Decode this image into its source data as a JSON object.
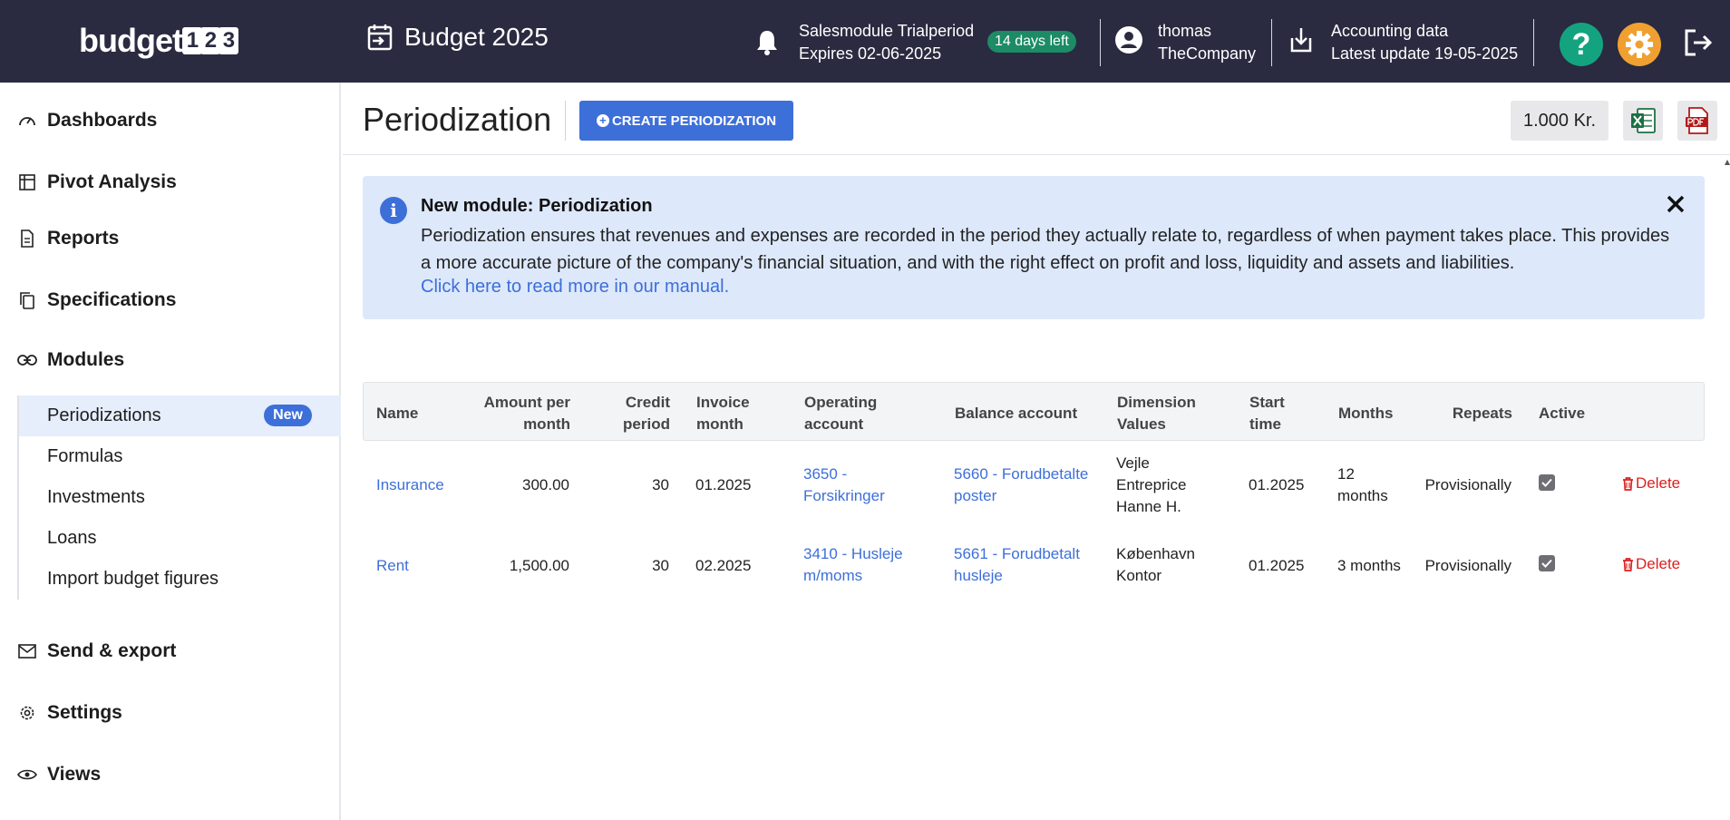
{
  "topbar": {
    "logo_text": "budget",
    "logo_digits": [
      "1",
      "2",
      "3"
    ],
    "budget_label": "Budget 2025",
    "trial_line1": "Salesmodule Trialperiod",
    "trial_line2": "Expires 02-06-2025",
    "days_left": "14 days left",
    "user_name": "thomas",
    "company": "TheCompany",
    "accounting_line1": "Accounting data",
    "accounting_line2": "Latest update 19-05-2025",
    "help_glyph": "?"
  },
  "sidebar": {
    "items": [
      {
        "label": "Dashboards",
        "icon": "gauge-icon"
      },
      {
        "label": "Pivot Analysis",
        "icon": "table-icon"
      },
      {
        "label": "Reports",
        "icon": "document-icon"
      },
      {
        "label": "Specifications",
        "icon": "copy-icon"
      },
      {
        "label": "Modules",
        "icon": "link-icon"
      },
      {
        "label": "Send & export",
        "icon": "envelope-icon"
      },
      {
        "label": "Settings",
        "icon": "gear-icon"
      },
      {
        "label": "Views",
        "icon": "eye-icon"
      }
    ],
    "sub_items": [
      {
        "label": "Periodizations",
        "badge": "New",
        "active": true
      },
      {
        "label": "Formulas"
      },
      {
        "label": "Investments"
      },
      {
        "label": "Loans"
      },
      {
        "label": "Import budget figures"
      }
    ]
  },
  "header": {
    "title": "Periodization",
    "create_label": "CREATE PERIODIZATION",
    "create_glyph": "+",
    "unit_label": "1.000 Kr."
  },
  "info": {
    "icon_glyph": "i",
    "title": "New module: Periodization",
    "text": "Periodization ensures that revenues and expenses are recorded in the period they actually relate to, regardless of when payment takes place. This provides a more accurate picture of the company's financial situation, and with the right effect on profit and loss, liquidity and assets and liabilities.",
    "link": "Click here to read more in our manual."
  },
  "table": {
    "headers": {
      "name": "Name",
      "amount": [
        "Amount per",
        "month"
      ],
      "credit": [
        "Credit",
        "period"
      ],
      "invoice": [
        "Invoice",
        "month"
      ],
      "operating": [
        "Operating",
        "account"
      ],
      "balance": "Balance account",
      "dimension": [
        "Dimension",
        "Values"
      ],
      "start": [
        "Start",
        "time"
      ],
      "months": "Months",
      "repeats": "Repeats",
      "active": "Active"
    },
    "rows": [
      {
        "name": "Insurance",
        "amount": "300.00",
        "credit": "30",
        "invoice": "01.2025",
        "operating": [
          "3650 -",
          "Forsikringer"
        ],
        "balance": [
          "5660 - Forudbetalte",
          "poster"
        ],
        "dimension": [
          "Vejle",
          "Entreprice",
          "Hanne H."
        ],
        "start": "01.2025",
        "months": [
          "12",
          "months"
        ],
        "repeats": "Provisionally",
        "active": true,
        "delete": "Delete"
      },
      {
        "name": "Rent",
        "amount": "1,500.00",
        "credit": "30",
        "invoice": "02.2025",
        "operating": [
          "3410 - Husleje",
          "m/moms"
        ],
        "balance": [
          "5661 - Forudbetalt",
          "husleje"
        ],
        "dimension": [
          "København",
          "Kontor"
        ],
        "start": "01.2025",
        "months": [
          "3 months"
        ],
        "repeats": "Provisionally",
        "active": true,
        "delete": "Delete"
      }
    ]
  },
  "colors": {
    "topbar_bg": "#2a2a40",
    "accent": "#3d6fd9",
    "badge_green": "#1c8b66",
    "help": "#14a37f",
    "settings": "#f0a030",
    "danger": "#dc2020",
    "info_bg": "#dde8fb"
  }
}
